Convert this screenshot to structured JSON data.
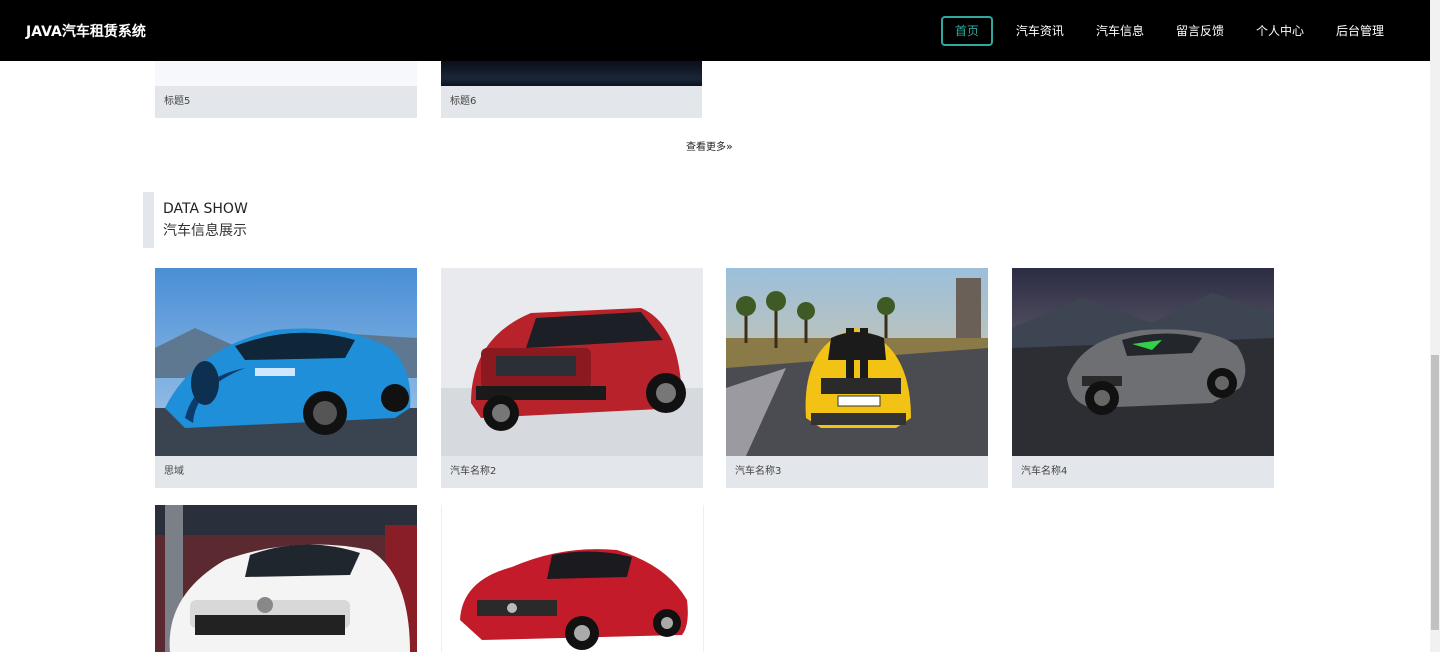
{
  "header": {
    "brand": "JAVA汽车租赁系统",
    "nav": [
      "首页",
      "汽车资讯",
      "汽车信息",
      "留言反馈",
      "个人中心",
      "后台管理"
    ]
  },
  "news_fragment": {
    "items": [
      {
        "title": "标题5"
      },
      {
        "title": "标题6"
      }
    ],
    "more_label": "查看更多"
  },
  "section": {
    "title_en": "DATA SHOW",
    "title_cn": "汽车信息展示"
  },
  "cars": [
    {
      "name": "思域",
      "color": "#1e8fd8"
    },
    {
      "name": "汽车名称2",
      "color": "#b8222a"
    },
    {
      "name": "汽车名称3",
      "color": "#f2c315"
    },
    {
      "name": "汽车名称4",
      "color": "#6d6f73"
    },
    {
      "name": "",
      "color": "#f4f4f4"
    },
    {
      "name": "",
      "color": "#c41b2a"
    }
  ],
  "accent_color": "#2fa8a0"
}
